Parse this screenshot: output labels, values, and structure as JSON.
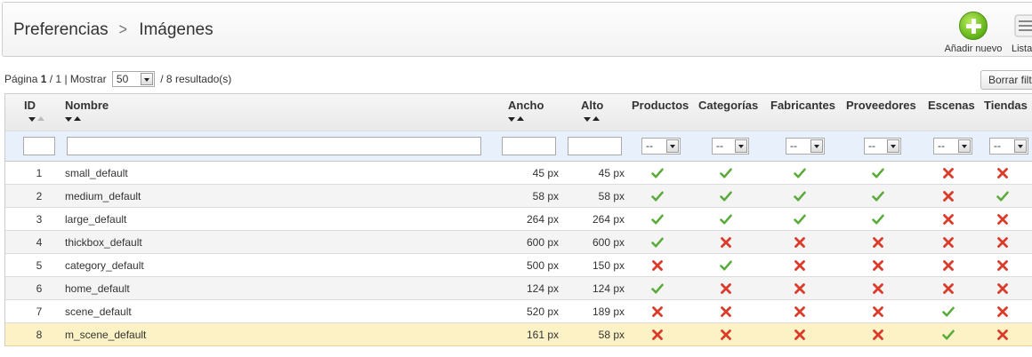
{
  "breadcrumb": {
    "parent": "Preferencias",
    "separator": ">",
    "current": "Imágenes"
  },
  "toolbar": {
    "add_label": "Añadir nuevo",
    "list_label": "Lista"
  },
  "pager": {
    "page_label": "Página",
    "current_page": "1",
    "total_pages": "1",
    "show_label": "Mostrar",
    "per_page": "50",
    "results": "/ 8 resultado(s)"
  },
  "reset_filter_label": "Borrar filtro",
  "columns": [
    "ID",
    "Nombre",
    "Ancho",
    "Alto",
    "Productos",
    "Categorías",
    "Fabricantes",
    "Proveedores",
    "Escenas",
    "Tiendas"
  ],
  "filter_option": "--",
  "colors": {
    "yes": "#5aab3c",
    "no": "#d93c2a",
    "highlight_row": "#fdf2c5"
  },
  "rows": [
    {
      "id": "1",
      "name": "small_default",
      "width": "45 px",
      "height": "45 px",
      "products": true,
      "categories": true,
      "manufacturers": true,
      "suppliers": true,
      "scenes": false,
      "stores": false
    },
    {
      "id": "2",
      "name": "medium_default",
      "width": "58 px",
      "height": "58 px",
      "products": true,
      "categories": true,
      "manufacturers": true,
      "suppliers": true,
      "scenes": false,
      "stores": true
    },
    {
      "id": "3",
      "name": "large_default",
      "width": "264 px",
      "height": "264 px",
      "products": true,
      "categories": true,
      "manufacturers": true,
      "suppliers": true,
      "scenes": false,
      "stores": false
    },
    {
      "id": "4",
      "name": "thickbox_default",
      "width": "600 px",
      "height": "600 px",
      "products": true,
      "categories": false,
      "manufacturers": false,
      "suppliers": false,
      "scenes": false,
      "stores": false
    },
    {
      "id": "5",
      "name": "category_default",
      "width": "500 px",
      "height": "150 px",
      "products": false,
      "categories": true,
      "manufacturers": false,
      "suppliers": false,
      "scenes": false,
      "stores": false
    },
    {
      "id": "6",
      "name": "home_default",
      "width": "124 px",
      "height": "124 px",
      "products": true,
      "categories": false,
      "manufacturers": false,
      "suppliers": false,
      "scenes": false,
      "stores": false
    },
    {
      "id": "7",
      "name": "scene_default",
      "width": "520 px",
      "height": "189 px",
      "products": false,
      "categories": false,
      "manufacturers": false,
      "suppliers": false,
      "scenes": true,
      "stores": false
    },
    {
      "id": "8",
      "name": "m_scene_default",
      "width": "161 px",
      "height": "58 px",
      "products": false,
      "categories": false,
      "manufacturers": false,
      "suppliers": false,
      "scenes": true,
      "stores": false
    }
  ]
}
